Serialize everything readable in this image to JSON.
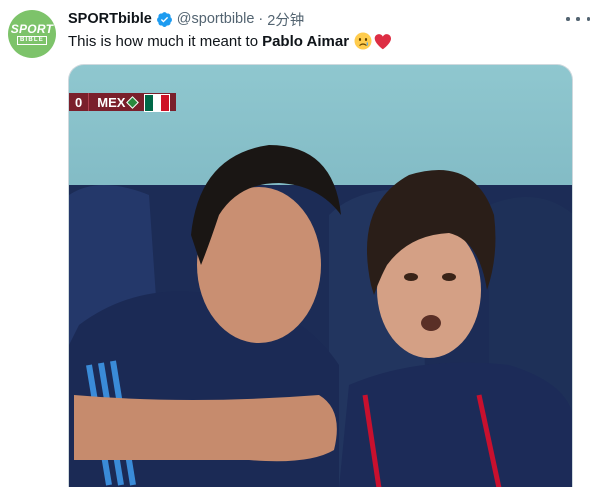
{
  "tweet": {
    "display_name": "SPORTbible",
    "handle": "@sportbible",
    "separator": "·",
    "time": "2分钟",
    "text_prefix": "This is how much it meant to",
    "text_bold": "Pablo Aimar",
    "emojis": [
      "crying-face",
      "red-heart"
    ]
  },
  "avatar": {
    "logo_top": "SPORT",
    "logo_bottom": "BIBLE",
    "color": "#7dc36a"
  },
  "media": {
    "scoreboard": {
      "score": "0",
      "team": "MEX"
    },
    "flag_colors": [
      "#006847",
      "#ffffff",
      "#ce1126"
    ]
  },
  "colors": {
    "verified": "#1d9bf0",
    "text": "#0f1419",
    "muted": "#536471"
  }
}
